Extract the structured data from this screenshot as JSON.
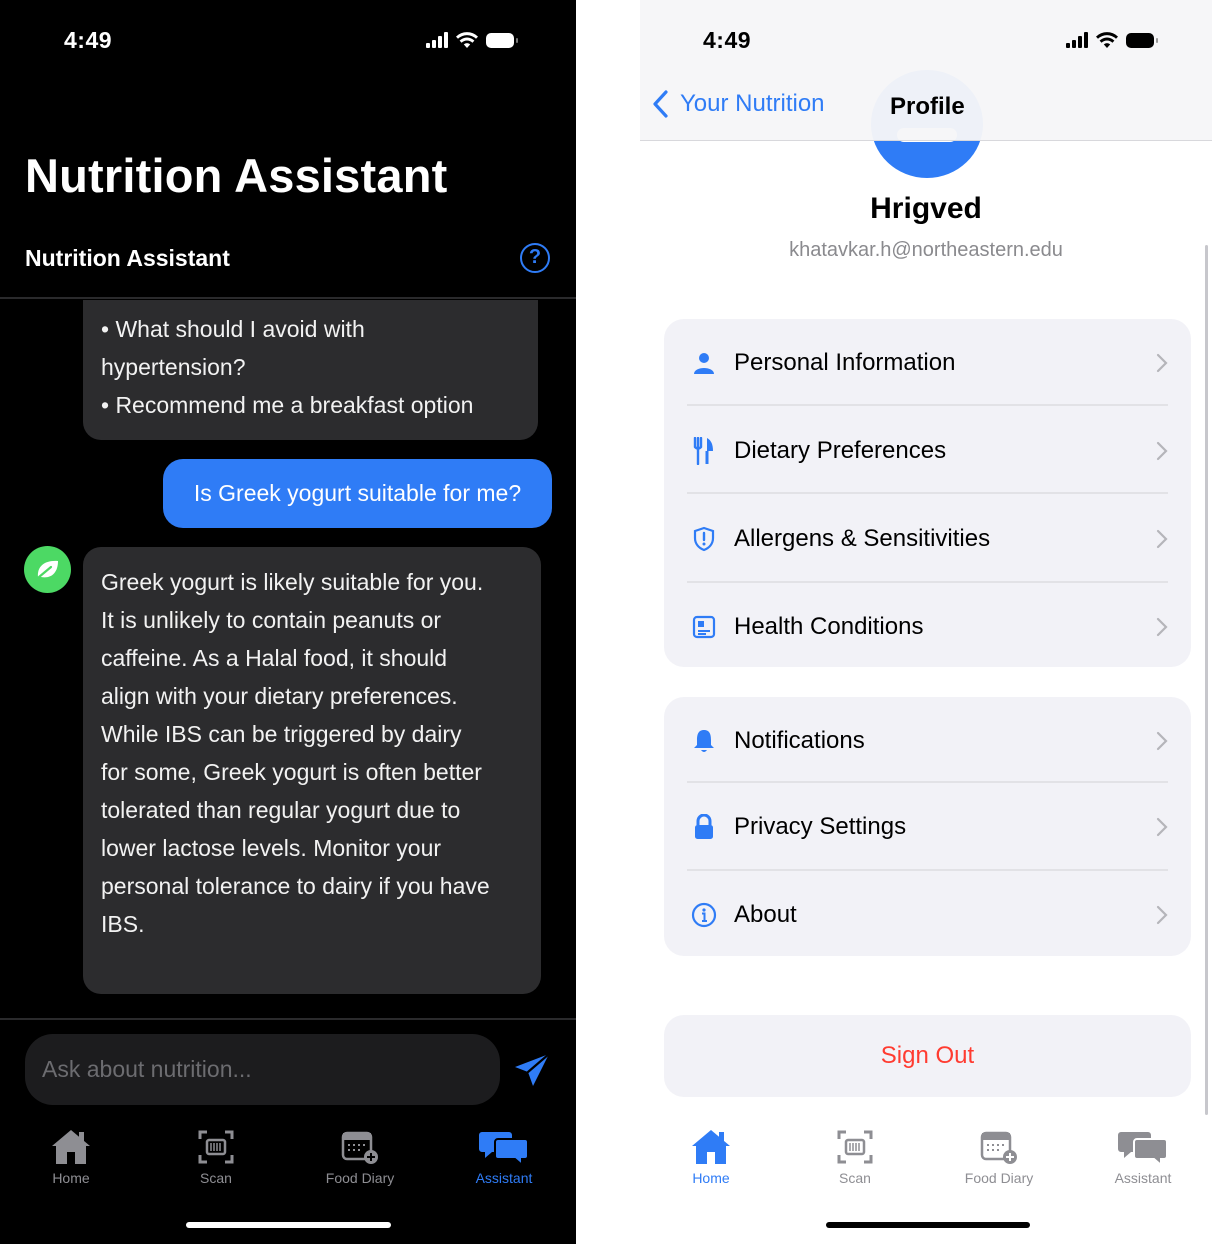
{
  "left": {
    "status": {
      "time": "4:49"
    },
    "title": "Nutrition Assistant",
    "chat_header": {
      "title": "Nutrition Assistant",
      "help_icon": "question-circle-icon"
    },
    "messages": [
      {
        "role": "assistant",
        "lines": [
          "• What should I avoid with",
          "hypertension?",
          "• Recommend me a breakfast option"
        ]
      },
      {
        "role": "user",
        "text": "Is Greek yogurt suitable for me?"
      },
      {
        "role": "assistant",
        "lines": [
          "Greek yogurt is likely suitable for you.",
          "It is unlikely to contain peanuts or",
          "caffeine. As a Halal food, it should",
          "align with your dietary preferences.",
          "While IBS can be triggered by dairy",
          "for some, Greek yogurt is often better",
          "tolerated than regular yogurt due to",
          "lower lactose levels. Monitor your",
          "personal tolerance to dairy if you have",
          "IBS."
        ]
      }
    ],
    "input": {
      "placeholder": "Ask about nutrition..."
    },
    "tabbar": [
      {
        "label": "Home",
        "icon": "house-icon",
        "active": false
      },
      {
        "label": "Scan",
        "icon": "barcode-scan-icon",
        "active": false
      },
      {
        "label": "Food Diary",
        "icon": "calendar-add-icon",
        "active": false
      },
      {
        "label": "Assistant",
        "icon": "chat-bubbles-icon",
        "active": true
      }
    ]
  },
  "right": {
    "status": {
      "time": "4:49"
    },
    "nav": {
      "back_label": "Your Nutrition",
      "title": "Profile"
    },
    "profile": {
      "name": "Hrigved",
      "email": "khatavkar.h@northeastern.edu"
    },
    "groups": [
      [
        {
          "label": "Personal Information",
          "icon": "person-icon"
        },
        {
          "label": "Dietary Preferences",
          "icon": "fork-knife-icon"
        },
        {
          "label": "Allergens & Sensitivities",
          "icon": "shield-alert-icon"
        },
        {
          "label": "Health Conditions",
          "icon": "medical-chart-icon"
        }
      ],
      [
        {
          "label": "Notifications",
          "icon": "bell-icon"
        },
        {
          "label": "Privacy Settings",
          "icon": "lock-icon"
        },
        {
          "label": "About",
          "icon": "info-circle-icon"
        }
      ]
    ],
    "sign_out": "Sign Out",
    "tabbar": [
      {
        "label": "Home",
        "icon": "house-icon",
        "active": true
      },
      {
        "label": "Scan",
        "icon": "barcode-scan-icon",
        "active": false
      },
      {
        "label": "Food Diary",
        "icon": "calendar-add-icon",
        "active": false
      },
      {
        "label": "Assistant",
        "icon": "chat-bubbles-icon",
        "active": false
      }
    ]
  },
  "colors": {
    "accent": "#2f7cf6",
    "assistant_avatar": "#4cd964",
    "destructive": "#ff3b30",
    "bubble_dark": "#2c2c2e"
  }
}
